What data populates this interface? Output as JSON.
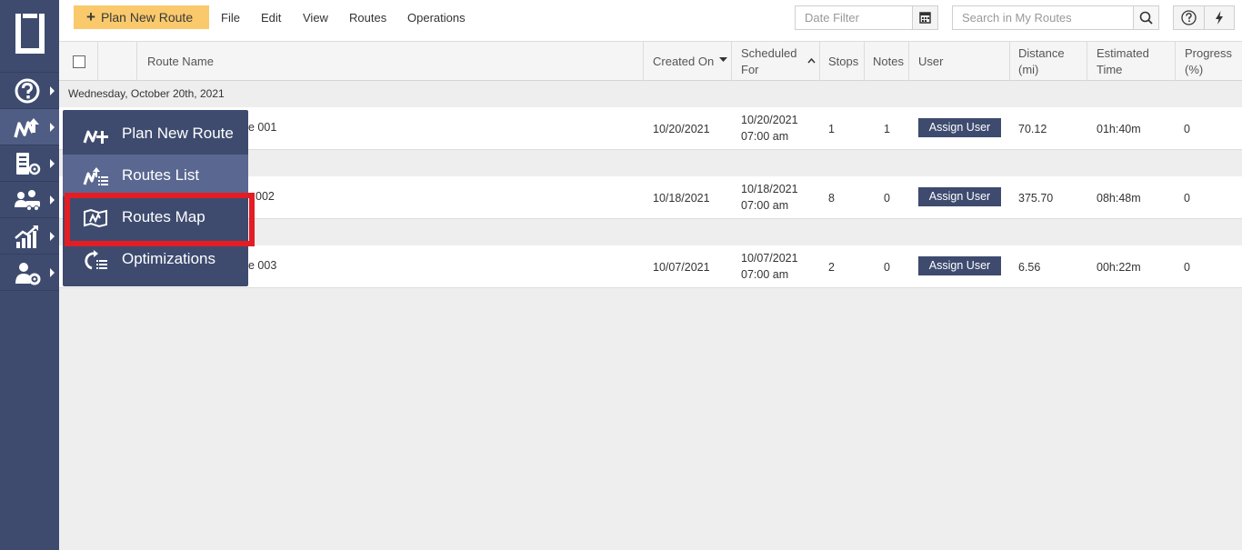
{
  "toolbar": {
    "plan_new_route": "Plan New Route",
    "menus": [
      "File",
      "Edit",
      "View",
      "Routes",
      "Operations"
    ],
    "date_filter_placeholder": "Date Filter",
    "search_placeholder": "Search in My Routes"
  },
  "sidebar": {
    "items": [
      "help-icon",
      "routes-icon",
      "orders-icon",
      "team-icon",
      "analytics-icon",
      "settings-icon"
    ]
  },
  "table": {
    "headers": {
      "route_name": "Route Name",
      "created_on": "Created On",
      "scheduled_for_1": "Scheduled",
      "scheduled_for_2": "For",
      "stops": "Stops",
      "notes": "Notes",
      "user": "User",
      "distance_1": "Distance",
      "distance_2": "(mi)",
      "est_time_1": "Estimated",
      "est_time_2": "Time",
      "progress_1": "Progress",
      "progress_2": "(%)"
    },
    "group_label": "Wednesday, October 20th, 2021",
    "assign_label": "Assign User",
    "rows": [
      {
        "name_suffix": "e 001",
        "created": "10/20/2021",
        "sched_date": "10/20/2021",
        "sched_time": "07:00 am",
        "stops": "1",
        "notes": "1",
        "distance": "70.12",
        "time": "01h:40m",
        "progress": "0"
      },
      {
        "name_suffix": "002",
        "created": "10/18/2021",
        "sched_date": "10/18/2021",
        "sched_time": "07:00 am",
        "stops": "8",
        "notes": "0",
        "distance": "375.70",
        "time": "08h:48m",
        "progress": "0"
      },
      {
        "name_suffix": "e 003",
        "created": "10/07/2021",
        "sched_date": "10/07/2021",
        "sched_time": "07:00 am",
        "stops": "2",
        "notes": "0",
        "distance": "6.56",
        "time": "00h:22m",
        "progress": "0"
      }
    ]
  },
  "flyout": {
    "items": [
      "Plan New Route",
      "Routes List",
      "Routes Map",
      "Optimizations"
    ]
  }
}
